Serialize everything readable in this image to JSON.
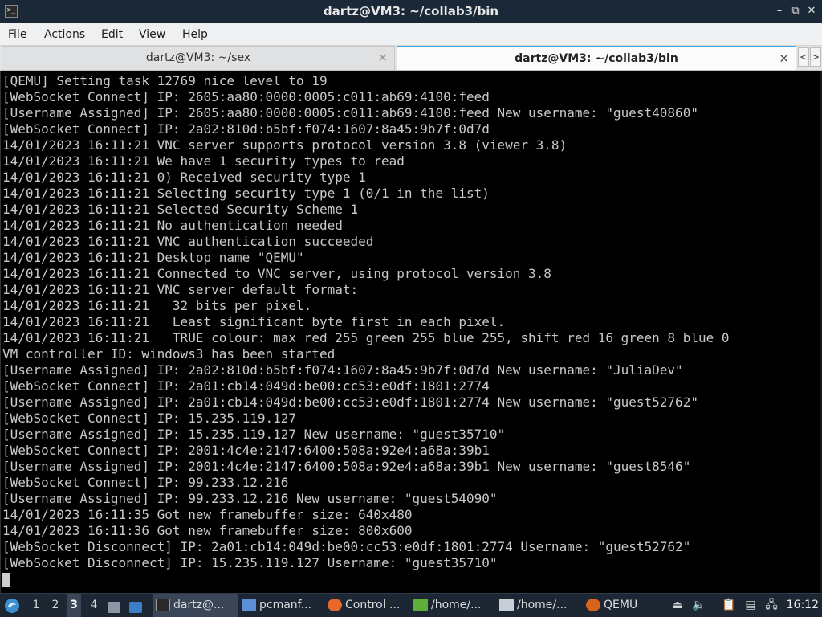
{
  "window": {
    "title": "dartz@VM3: ~/collab3/bin",
    "controls": [
      "–",
      "⧉",
      "✕"
    ]
  },
  "menu": [
    "File",
    "Actions",
    "Edit",
    "View",
    "Help"
  ],
  "tabs": [
    {
      "label": "dartz@VM3: ~/sex",
      "active": false,
      "close": "✕"
    },
    {
      "label": "dartz@VM3: ~/collab3/bin",
      "active": true,
      "close": "✕"
    }
  ],
  "tab_nav": {
    "prev": "<",
    "next": ">"
  },
  "terminal": {
    "lines": [
      "[QEMU] Setting task 12769 nice level to 19",
      "[WebSocket Connect] IP: 2605:aa80:0000:0005:c011:ab69:4100:feed",
      "[Username Assigned] IP: 2605:aa80:0000:0005:c011:ab69:4100:feed New username: \"guest40860\"",
      "[WebSocket Connect] IP: 2a02:810d:b5bf:f074:1607:8a45:9b7f:0d7d",
      "14/01/2023 16:11:21 VNC server supports protocol version 3.8 (viewer 3.8)",
      "14/01/2023 16:11:21 We have 1 security types to read",
      "14/01/2023 16:11:21 0) Received security type 1",
      "14/01/2023 16:11:21 Selecting security type 1 (0/1 in the list)",
      "14/01/2023 16:11:21 Selected Security Scheme 1",
      "14/01/2023 16:11:21 No authentication needed",
      "14/01/2023 16:11:21 VNC authentication succeeded",
      "14/01/2023 16:11:21 Desktop name \"QEMU\"",
      "14/01/2023 16:11:21 Connected to VNC server, using protocol version 3.8",
      "14/01/2023 16:11:21 VNC server default format:",
      "14/01/2023 16:11:21   32 bits per pixel.",
      "14/01/2023 16:11:21   Least significant byte first in each pixel.",
      "14/01/2023 16:11:21   TRUE colour: max red 255 green 255 blue 255, shift red 16 green 8 blue 0",
      "VM controller ID: windows3 has been started",
      "[Username Assigned] IP: 2a02:810d:b5bf:f074:1607:8a45:9b7f:0d7d New username: \"JuliaDev\"",
      "[WebSocket Connect] IP: 2a01:cb14:049d:be00:cc53:e0df:1801:2774",
      "[Username Assigned] IP: 2a01:cb14:049d:be00:cc53:e0df:1801:2774 New username: \"guest52762\"",
      "[WebSocket Connect] IP: 15.235.119.127",
      "[Username Assigned] IP: 15.235.119.127 New username: \"guest35710\"",
      "[WebSocket Connect] IP: 2001:4c4e:2147:6400:508a:92e4:a68a:39b1",
      "[Username Assigned] IP: 2001:4c4e:2147:6400:508a:92e4:a68a:39b1 New username: \"guest8546\"",
      "[WebSocket Connect] IP: 99.233.12.216",
      "[Username Assigned] IP: 99.233.12.216 New username: \"guest54090\"",
      "14/01/2023 16:11:35 Got new framebuffer size: 640x480",
      "14/01/2023 16:11:36 Got new framebuffer size: 800x600",
      "[WebSocket Disconnect] IP: 2a01:cb14:049d:be00:cc53:e0df:1801:2774 Username: \"guest52762\"",
      "[WebSocket Disconnect] IP: 15.235.119.127 Username: \"guest35710\""
    ]
  },
  "taskbar": {
    "workspaces": [
      "1",
      "2",
      "3",
      "4"
    ],
    "active_workspace": "3",
    "tasks": [
      {
        "label": "dartz@...",
        "icon": "terminal-icon"
      },
      {
        "label": "pcmanf...",
        "icon": "folder-icon"
      },
      {
        "label": "Control ...",
        "icon": "firefox-icon"
      },
      {
        "label": "/home/...",
        "icon": "text-editor-icon"
      },
      {
        "label": "/home/...",
        "icon": "image-viewer-icon"
      },
      {
        "label": "QEMU",
        "icon": "qemu-icon"
      }
    ],
    "clock": "16:12"
  },
  "colors": {
    "terminal_bg": "#000000",
    "terminal_fg": "#c9c9c9",
    "accent": "#3daee9",
    "titlebar_bg": "#1b2838",
    "taskbar_bg": "#1d2734"
  }
}
